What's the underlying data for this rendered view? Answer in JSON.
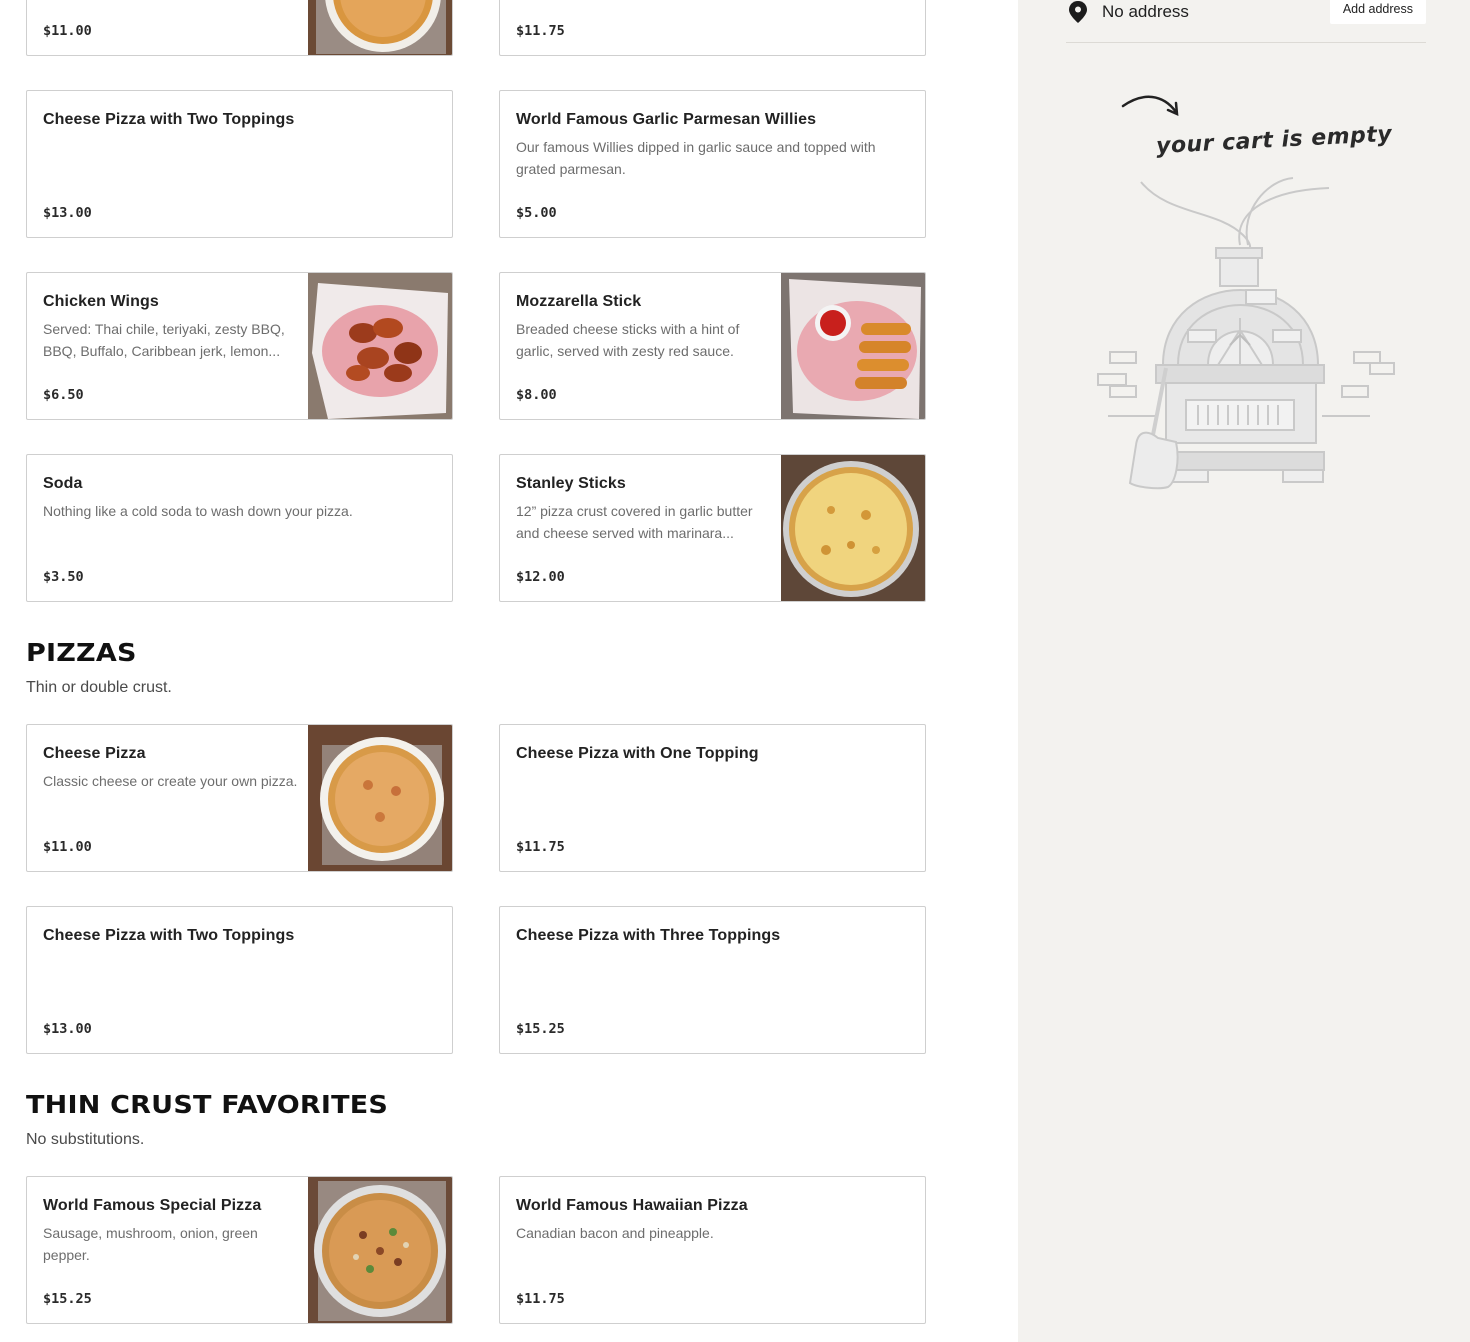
{
  "top_items": [
    {
      "price": "$11.00"
    },
    {
      "price": "$11.75"
    }
  ],
  "extras": [
    {
      "title": "Cheese Pizza with Two Toppings",
      "desc": "",
      "price": "$13.00"
    },
    {
      "title": "World Famous Garlic Parmesan Willies",
      "desc": "Our famous Willies dipped in garlic sauce and topped with grated parmesan.",
      "price": "$5.00"
    },
    {
      "title": "Chicken Wings",
      "desc": "Served: Thai chile, teriyaki, zesty BBQ, BBQ, Buffalo, Caribbean jerk, lemon...",
      "price": "$6.50"
    },
    {
      "title": "Mozzarella Stick",
      "desc": "Breaded cheese sticks with a hint of garlic, served with zesty red sauce.",
      "price": "$8.00"
    },
    {
      "title": "Soda",
      "desc": "Nothing like a cold soda to wash down your pizza.",
      "price": "$3.50"
    },
    {
      "title": "Stanley Sticks",
      "desc": "12” pizza crust covered in garlic butter and cheese served with marinara...",
      "price": "$12.00"
    }
  ],
  "pizzas": {
    "title": "PIZZAS",
    "subtitle": "Thin or double crust.",
    "items": [
      {
        "title": "Cheese Pizza",
        "desc": "Classic cheese or create your own pizza.",
        "price": "$11.00"
      },
      {
        "title": "Cheese Pizza with One Topping",
        "desc": "",
        "price": "$11.75"
      },
      {
        "title": "Cheese Pizza with Two Toppings",
        "desc": "",
        "price": "$13.00"
      },
      {
        "title": "Cheese Pizza with Three Toppings",
        "desc": "",
        "price": "$15.25"
      }
    ]
  },
  "thin_crust": {
    "title": "THIN CRUST FAVORITES",
    "subtitle": "No substitutions.",
    "items": [
      {
        "title": "World Famous Special Pizza",
        "desc": "Sausage, mushroom, onion, green pepper.",
        "price": "$15.25"
      },
      {
        "title": "World Famous Hawaiian Pizza",
        "desc": "Canadian bacon and pineapple.",
        "price": "$11.75"
      }
    ]
  },
  "sidebar": {
    "address_text": "No address",
    "add_address_label": "Add address",
    "cart_empty_label": "your cart is empty"
  },
  "colors": {
    "sidebar_bg": "#f3f2ef",
    "card_border": "#cfcfcf"
  },
  "icons": {
    "pin": "location-pin-icon",
    "arrow": "curved-arrow-icon",
    "oven": "pizza-oven-illustration"
  }
}
